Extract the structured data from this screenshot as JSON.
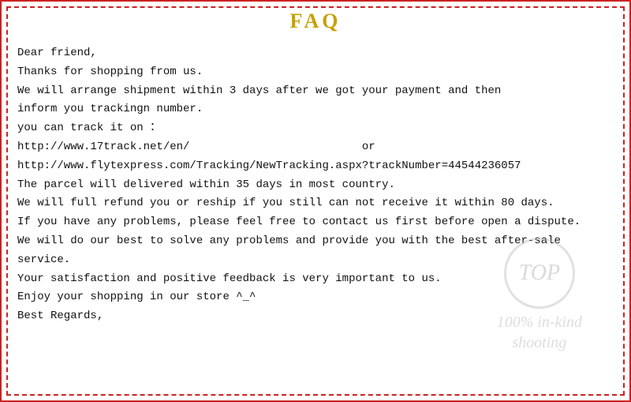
{
  "header": {
    "title": "FAQ"
  },
  "content": {
    "lines": [
      "Dear friend,",
      "Thanks for shopping from us.",
      "We will arrange shipment within 3 days after we got your payment and then",
      "inform you trackingn number.",
      "you can track it on ：",
      "http://www.17track.net/en/                          or",
      "http://www.flytexpress.com/Tracking/NewTracking.aspx?trackNumber=44544236057",
      "The parcel will delivered within 35 days in most country.",
      "We will full refund you or reship if you still can not receive it within 80 days.",
      "If you have any problems, please feel free to contact us first before open a dispute.",
      "We will do our best to solve any problems and provide you with the best after-sale",
      "service.",
      "Your satisfaction and positive feedback is very important to us.",
      "Enjoy your shopping in our store ^_^",
      "Best Regards,"
    ]
  },
  "watermark": {
    "circle_text": "TOP",
    "line1": "100% in-kind",
    "line2": "shooting"
  }
}
